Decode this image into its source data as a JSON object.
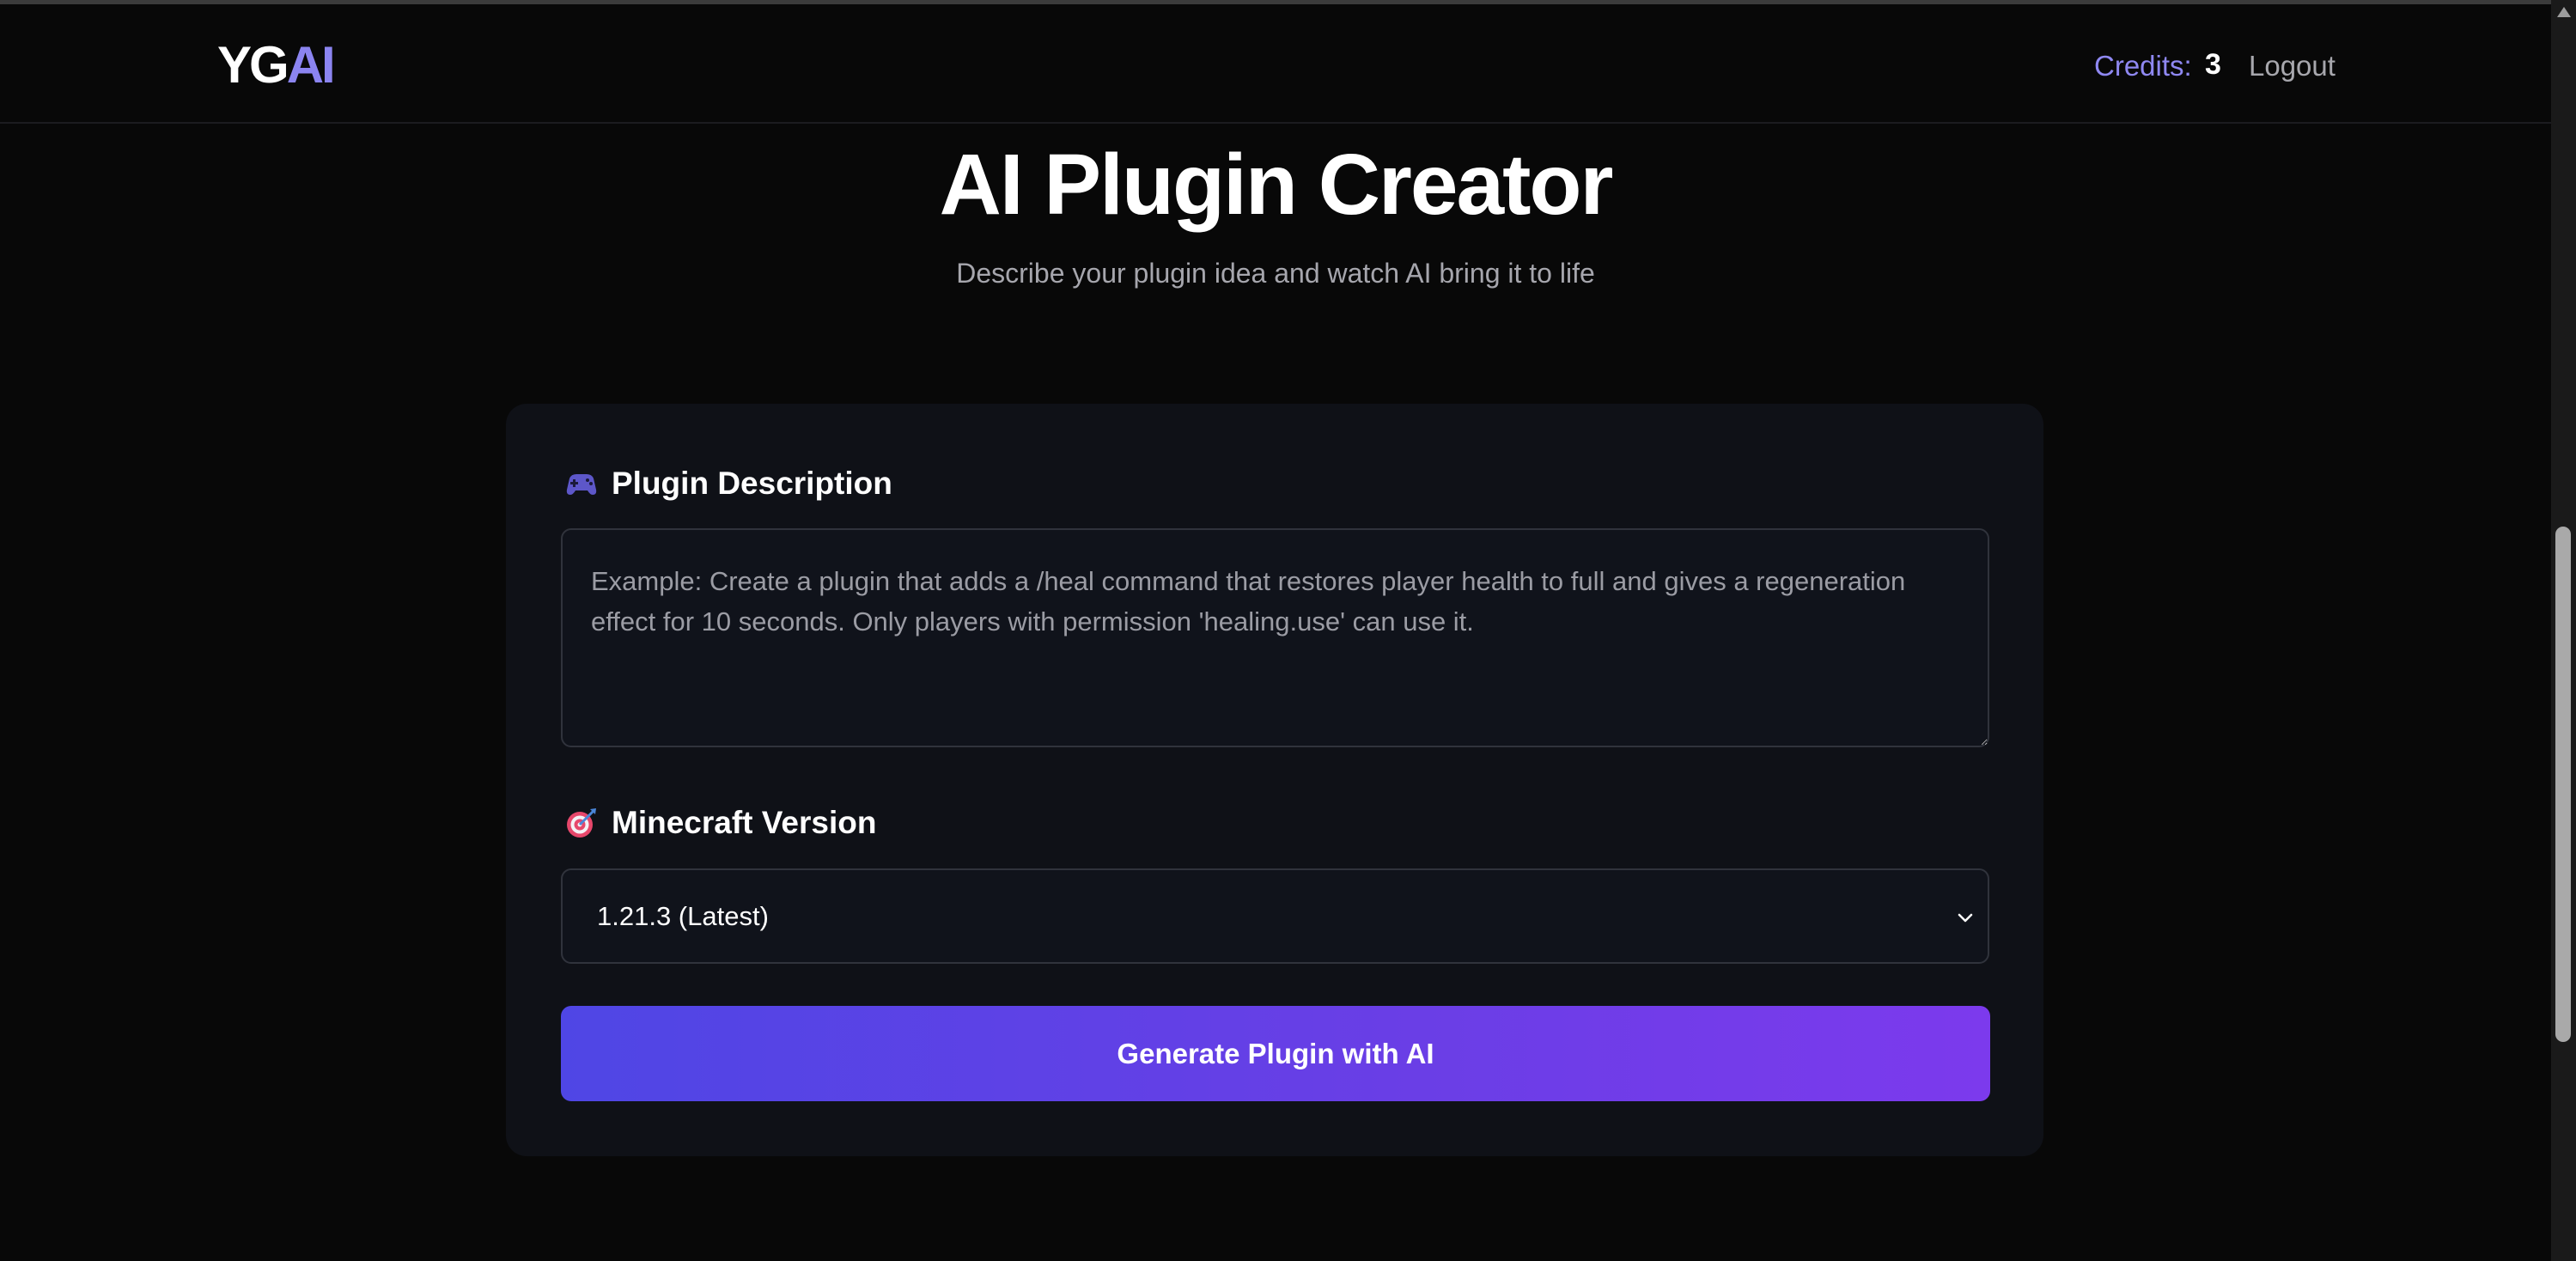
{
  "header": {
    "logo_part1": "YG",
    "logo_part2": "AI",
    "credits_label": "Credits:",
    "credits_value": "3",
    "logout_label": "Logout"
  },
  "hero": {
    "title": "AI Plugin Creator",
    "subtitle": "Describe your plugin idea and watch AI bring it to life"
  },
  "form": {
    "description_label": "Plugin Description",
    "description_icon": "gamepad-icon",
    "description_value": "",
    "description_placeholder": "Example: Create a plugin that adds a /heal command that restores player health to full and gives a regeneration effect for 10 seconds. Only players with permission 'healing.use' can use it.",
    "version_label": "Minecraft Version",
    "version_icon": "target-icon",
    "version_selected": "1.21.3 (Latest)",
    "generate_label": "Generate Plugin with AI"
  },
  "colors": {
    "accent": "#8b84f0",
    "button_gradient_start": "#4f46e5",
    "button_gradient_end": "#7c3aed",
    "card_background": "#0f1117",
    "page_background": "#080808"
  }
}
